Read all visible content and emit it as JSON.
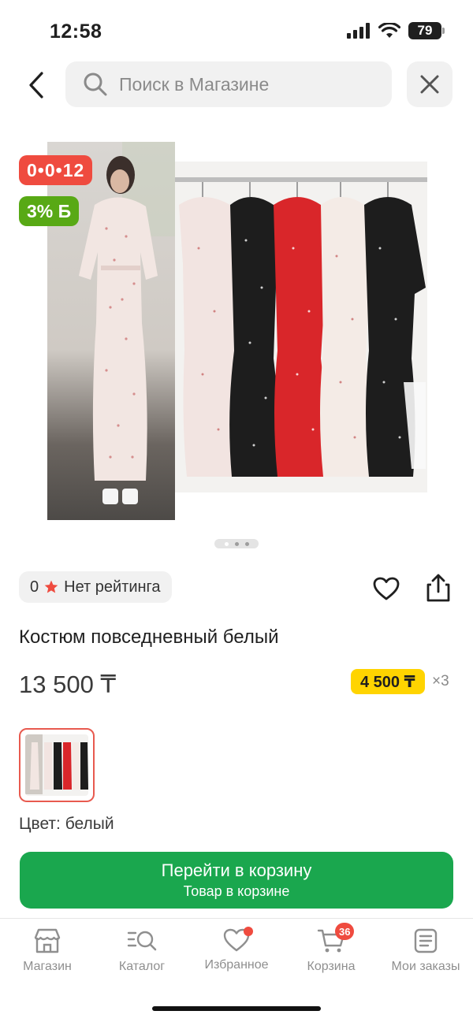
{
  "status_bar": {
    "time": "12:58",
    "battery": "79"
  },
  "search": {
    "placeholder": "Поиск в Магазине"
  },
  "badges": {
    "timer": "0•0•12",
    "bonus": "3% Б"
  },
  "product": {
    "rating_value": "0",
    "rating_text": "Нет рейтинга",
    "title": "Костюм повседневный белый",
    "price": "13 500 ₸",
    "installment_price": "4 500 ₸",
    "installment_multiplier": "×3",
    "color_label": "Цвет: белый"
  },
  "gallery": {
    "page_count": 3,
    "active_index": 0
  },
  "cart_button": {
    "main": "Перейти в корзину",
    "sub": "Товар в корзине"
  },
  "tabbar": {
    "items": [
      {
        "label": "Магазин",
        "icon": "shop-icon"
      },
      {
        "label": "Каталог",
        "icon": "catalog-search-icon"
      },
      {
        "label": "Избранное",
        "icon": "heart-icon"
      },
      {
        "label": "Корзина",
        "icon": "cart-icon"
      },
      {
        "label": "Мои заказы",
        "icon": "orders-icon"
      }
    ],
    "cart_badge": "36"
  },
  "colors": {
    "accent_green": "#1aa74e",
    "badge_red": "#ef4b3f",
    "bonus_green": "#58a915",
    "installment_yellow": "#ffd400"
  }
}
